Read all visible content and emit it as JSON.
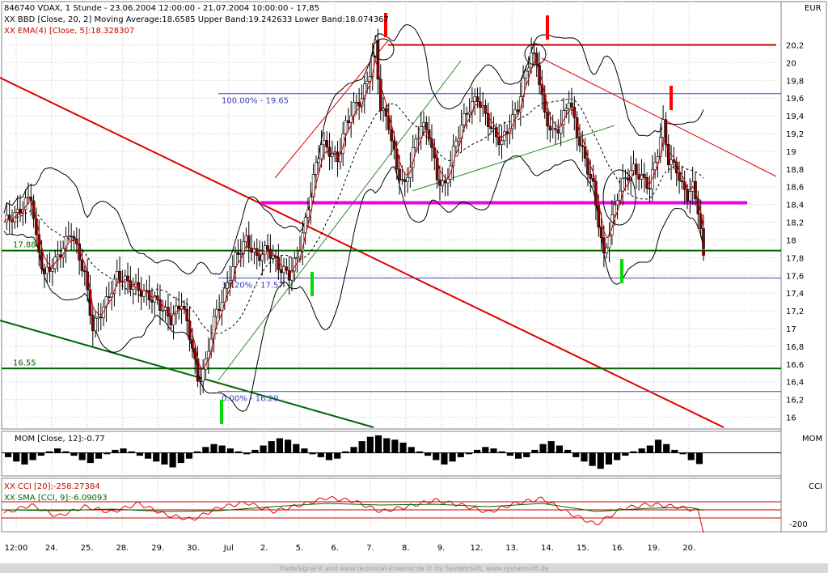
{
  "header": {
    "title": "846740  VDAX, 1 Stunde - 23.06.2004 12:00:00 - 21.07.2004 10:00:00 - 17,85",
    "bbd": "XX BBD [Close, 20, 2] Moving Average:18.6585 Upper Band:19.242633 Lower Band:18.074367",
    "ema": "XX EMA(4) [Close, 5]:18.328307"
  },
  "panels": {
    "main_unit": "EUR",
    "mom_label": "MOM [Close, 12]:-0.77",
    "mom_unit": "MOM",
    "cci_label": "XX CCI [20]:-258.27384",
    "sma_label": "XX SMA [CCI, 9]:-6.09093",
    "cci_unit": "CCI",
    "cci_tick": "-200"
  },
  "footer": "TradeSignal® and www.technical-investor.de © by SystemSoft, www.systemsoft.de",
  "colors": {
    "candle_up": "#ffffff",
    "candle_down": "#8b0000",
    "bands": "#000000",
    "ema": "#cc0000",
    "red_trend": "#dd0000",
    "green_trend": "#006400",
    "magenta": "#ee00ee",
    "fib": "#4040c0",
    "marker_red": "#ff0000",
    "marker_green": "#00dd00"
  },
  "chart_data": {
    "type": "candlestick",
    "ylim": [
      15.8,
      20.5
    ],
    "yticks": [
      16,
      16.2,
      16.4,
      16.6,
      16.8,
      17,
      17.2,
      17.4,
      17.6,
      17.8,
      18,
      18.2,
      18.4,
      18.6,
      18.8,
      19,
      19.2,
      19.4,
      19.6,
      19.8,
      20,
      20.2
    ],
    "x_ticks": [
      "12:00",
      "24.",
      "25.",
      "28.",
      "29.",
      "30.",
      "Jul",
      "2.",
      "5.",
      "6.",
      "7.",
      "8.",
      "9.",
      "12.",
      "13.",
      "14.",
      "15.",
      "16.",
      "19.",
      "20."
    ],
    "last_close": 17.85,
    "horizontal_levels": [
      {
        "label": "",
        "value": 20.2,
        "color": "red"
      },
      {
        "label": "17.88",
        "value": 17.88,
        "color": "green"
      },
      {
        "label": "16.55",
        "value": 16.55,
        "color": "green"
      },
      {
        "label": "",
        "value": 18.42,
        "color": "magenta"
      }
    ],
    "fibonacci": [
      {
        "label": "100.00% - 19.65",
        "value": 19.65
      },
      {
        "label": "38.20% - 17.57",
        "value": 17.57
      },
      {
        "label": "0.00% - 16.29",
        "value": 16.29
      }
    ],
    "close_path": [
      [
        0,
        18.2
      ],
      [
        5,
        18.3
      ],
      [
        10,
        18.5
      ],
      [
        12,
        18.0
      ],
      [
        15,
        17.6
      ],
      [
        20,
        17.8
      ],
      [
        25,
        18.1
      ],
      [
        30,
        17.6
      ],
      [
        33,
        17.0
      ],
      [
        38,
        17.3
      ],
      [
        42,
        17.6
      ],
      [
        47,
        17.5
      ],
      [
        52,
        17.4
      ],
      [
        57,
        17.3
      ],
      [
        62,
        17.1
      ],
      [
        66,
        17.3
      ],
      [
        70,
        16.8
      ],
      [
        72,
        16.4
      ],
      [
        75,
        16.6
      ],
      [
        78,
        17.1
      ],
      [
        82,
        17.4
      ],
      [
        86,
        17.8
      ],
      [
        90,
        18.0
      ],
      [
        94,
        17.8
      ],
      [
        98,
        17.9
      ],
      [
        102,
        17.7
      ],
      [
        106,
        17.6
      ],
      [
        109,
        17.8
      ],
      [
        112,
        18.2
      ],
      [
        115,
        18.7
      ],
      [
        118,
        19.1
      ],
      [
        121,
        19.0
      ],
      [
        124,
        18.9
      ],
      [
        127,
        19.3
      ],
      [
        130,
        19.5
      ],
      [
        133,
        19.6
      ],
      [
        136,
        19.9
      ],
      [
        138,
        20.2
      ],
      [
        140,
        19.5
      ],
      [
        143,
        19.3
      ],
      [
        146,
        18.8
      ],
      [
        149,
        18.6
      ],
      [
        152,
        19.0
      ],
      [
        155,
        19.3
      ],
      [
        158,
        19.2
      ],
      [
        161,
        18.7
      ],
      [
        164,
        18.6
      ],
      [
        167,
        19.0
      ],
      [
        170,
        19.3
      ],
      [
        173,
        19.5
      ],
      [
        176,
        19.6
      ],
      [
        179,
        19.4
      ],
      [
        182,
        19.2
      ],
      [
        185,
        19.1
      ],
      [
        188,
        19.3
      ],
      [
        191,
        19.5
      ],
      [
        194,
        19.9
      ],
      [
        196,
        20.1
      ],
      [
        198,
        20.0
      ],
      [
        201,
        19.4
      ],
      [
        204,
        19.2
      ],
      [
        207,
        19.3
      ],
      [
        210,
        19.6
      ],
      [
        213,
        19.2
      ],
      [
        216,
        18.9
      ],
      [
        219,
        18.6
      ],
      [
        221,
        18.2
      ],
      [
        223,
        17.8
      ],
      [
        225,
        18.1
      ],
      [
        228,
        18.5
      ],
      [
        231,
        18.7
      ],
      [
        234,
        18.8
      ],
      [
        237,
        18.7
      ],
      [
        240,
        18.6
      ],
      [
        243,
        19.0
      ],
      [
        245,
        19.3
      ],
      [
        247,
        18.9
      ],
      [
        250,
        18.8
      ],
      [
        252,
        18.6
      ],
      [
        254,
        18.5
      ],
      [
        256,
        18.6
      ],
      [
        258,
        18.35
      ],
      [
        260,
        17.85
      ]
    ],
    "mom_values": [
      -0.3,
      -0.6,
      -0.8,
      -0.5,
      -0.2,
      0.1,
      0.3,
      0.1,
      -0.2,
      -0.5,
      -0.7,
      -0.4,
      -0.1,
      0.2,
      0.3,
      0.1,
      -0.2,
      -0.4,
      -0.6,
      -0.8,
      -1.0,
      -0.7,
      -0.4,
      0.1,
      0.4,
      0.6,
      0.5,
      0.3,
      0.1,
      -0.1,
      0.2,
      0.5,
      0.8,
      1.0,
      0.9,
      0.6,
      0.3,
      -0.1,
      -0.3,
      -0.5,
      -0.4,
      0.1,
      0.4,
      0.8,
      1.1,
      1.2,
      1.0,
      0.9,
      0.7,
      0.4,
      0.1,
      -0.2,
      -0.5,
      -0.8,
      -0.6,
      -0.3,
      -0.1,
      0.2,
      0.4,
      0.3,
      0.1,
      -0.2,
      -0.4,
      -0.3,
      0.2,
      0.6,
      0.8,
      0.5,
      0.2,
      -0.3,
      -0.6,
      -0.9,
      -1.1,
      -0.8,
      -0.5,
      -0.2,
      0.1,
      0.3,
      0.5,
      0.9,
      0.6,
      0.2,
      -0.1,
      -0.5,
      -0.77
    ],
    "cci_path": [
      [
        0,
        -40
      ],
      [
        10,
        60
      ],
      [
        20,
        -80
      ],
      [
        30,
        40
      ],
      [
        40,
        -30
      ],
      [
        50,
        80
      ],
      [
        60,
        -60
      ],
      [
        70,
        -120
      ],
      [
        80,
        30
      ],
      [
        90,
        90
      ],
      [
        100,
        -20
      ],
      [
        110,
        60
      ],
      [
        120,
        150
      ],
      [
        130,
        110
      ],
      [
        140,
        -20
      ],
      [
        150,
        40
      ],
      [
        160,
        120
      ],
      [
        170,
        60
      ],
      [
        180,
        -30
      ],
      [
        190,
        80
      ],
      [
        200,
        140
      ],
      [
        210,
        -40
      ],
      [
        220,
        -180
      ],
      [
        230,
        20
      ],
      [
        240,
        70
      ],
      [
        250,
        40
      ],
      [
        258,
        -10
      ],
      [
        260,
        -258
      ]
    ],
    "sma_path": [
      [
        0,
        0
      ],
      [
        20,
        -10
      ],
      [
        40,
        10
      ],
      [
        60,
        -20
      ],
      [
        80,
        -10
      ],
      [
        100,
        40
      ],
      [
        120,
        80
      ],
      [
        140,
        60
      ],
      [
        160,
        70
      ],
      [
        180,
        40
      ],
      [
        200,
        80
      ],
      [
        220,
        -20
      ],
      [
        240,
        20
      ],
      [
        255,
        30
      ],
      [
        260,
        -6
      ]
    ]
  }
}
